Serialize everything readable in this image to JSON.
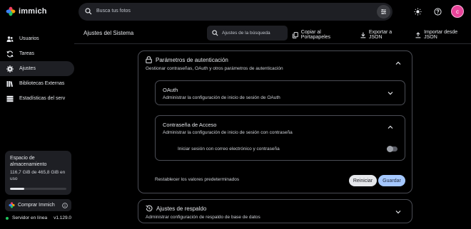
{
  "app": {
    "name": "immich"
  },
  "search": {
    "placeholder": "Busca tus fotos"
  },
  "user": {
    "initial": "c"
  },
  "sidebar": {
    "items": [
      {
        "label": "Usuarios",
        "icon": "users-icon",
        "active": false
      },
      {
        "label": "Tareas",
        "icon": "sync-icon",
        "active": false
      },
      {
        "label": "Ajustes",
        "icon": "gear-icon",
        "active": true
      },
      {
        "label": "Bibliotecas Externas",
        "icon": "library-icon",
        "active": false
      },
      {
        "label": "Estadísticas del serv",
        "icon": "server-icon",
        "active": false
      }
    ],
    "storage": {
      "title": "Espacio de almacenamiento",
      "used": "116,7 GiB de 465,8 GiB en uso",
      "fraction": 0.25
    },
    "buy_label": "Comprar Immich",
    "server_status": "Servidor en línea",
    "version": "v1.129.0"
  },
  "header": {
    "title": "Ajustes del Sistema",
    "settings_search_placeholder": "Ajustes de la búsqueda",
    "actions": {
      "copy": "Copiar al Portapapeles",
      "export": "Exportar a JSON",
      "import": "Importar desde JSON"
    }
  },
  "auth": {
    "title": "Parámetros de autenticación",
    "description": "Gestionar contraseñas, OAuth y otros parámetros de autenticación",
    "oauth": {
      "title": "OAuth",
      "description": "Administrar la configuración de inicio de sesión de OAuth"
    },
    "password": {
      "title": "Contraseña de Acceso",
      "description": "Administrar la configuración de inicio de sesión con contraseña",
      "toggle_label": "Iniciar sesión con correo electrónico y contraseña",
      "toggle_on": false
    },
    "reset_defaults": "Restablecer los valores predeterminados",
    "reset_button": "Reiniciar",
    "save_button": "Guardar"
  },
  "backup": {
    "title": "Ajustes de respaldo",
    "description": "Administrar configuración de respaldo de base de datos"
  },
  "colors": {
    "accent": "#a5c8ff",
    "online": "#22c55e",
    "avatar": "#e8449a"
  }
}
